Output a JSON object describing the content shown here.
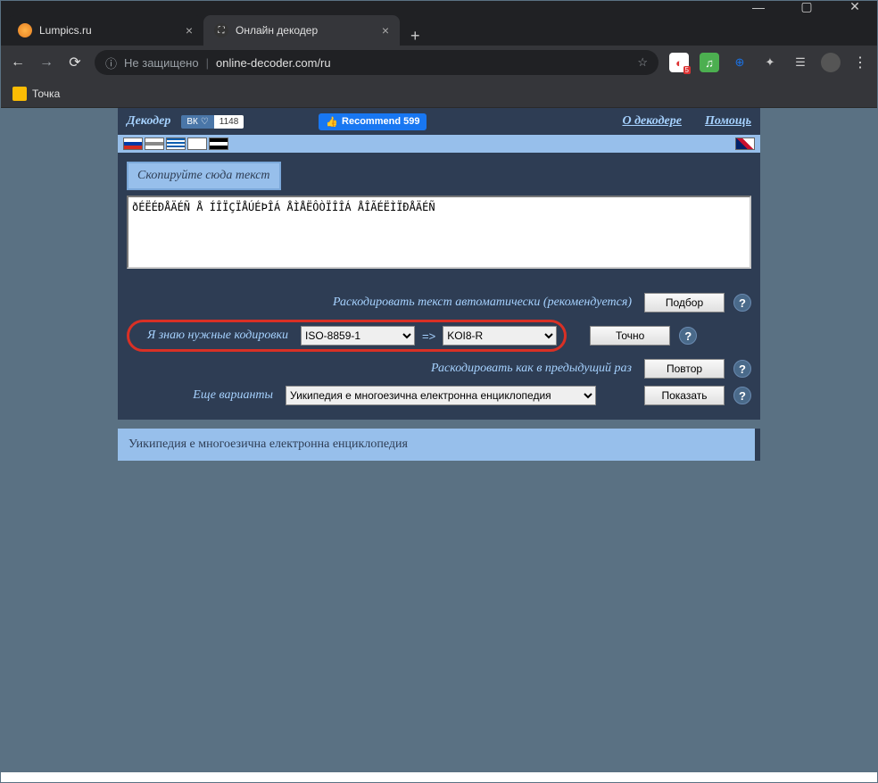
{
  "browser": {
    "tabs": [
      {
        "title": "Lumpics.ru",
        "active": false
      },
      {
        "title": "Онлайн декодер",
        "active": true
      }
    ],
    "security_label": "Не защищено",
    "url": "online-decoder.com/ru",
    "bookmarks": [
      {
        "label": "Точка"
      }
    ]
  },
  "nav": {
    "title": "Декодер",
    "vk_label": "ВК",
    "vk_count": "1148",
    "fb_label": "Recommend 599",
    "about_link": "О декодере",
    "help_link": "Помощь"
  },
  "panel": {
    "header": "Скопируйте сюда текст",
    "input_text": "ðÉËÉÐÅÄÉÑ Å ÍÎÏÇÏÅÚÉÞÎÁ ÅÌÅËÔÒÏÎÎÁ ÅÎÃÉËÌÏÐÅÄÉÑ"
  },
  "controls": {
    "auto_label": "Раскодировать текст автоматически (рекомендуется)",
    "auto_btn": "Подбор",
    "know_label": "Я знаю нужные кодировки",
    "from_enc": "ISO-8859-1",
    "to_enc": "KOI8-R",
    "arrow": "=>",
    "know_btn": "Точно",
    "prev_label": "Раскодировать как в предыдущий раз",
    "prev_btn": "Повтор",
    "more_label": "Еще варианты",
    "more_option": "Уикипедия е многоезична електронна енциклопедия",
    "more_btn": "Показать",
    "help": "?"
  },
  "result": "Уикипедия е многоезична електронна енциклопедия"
}
